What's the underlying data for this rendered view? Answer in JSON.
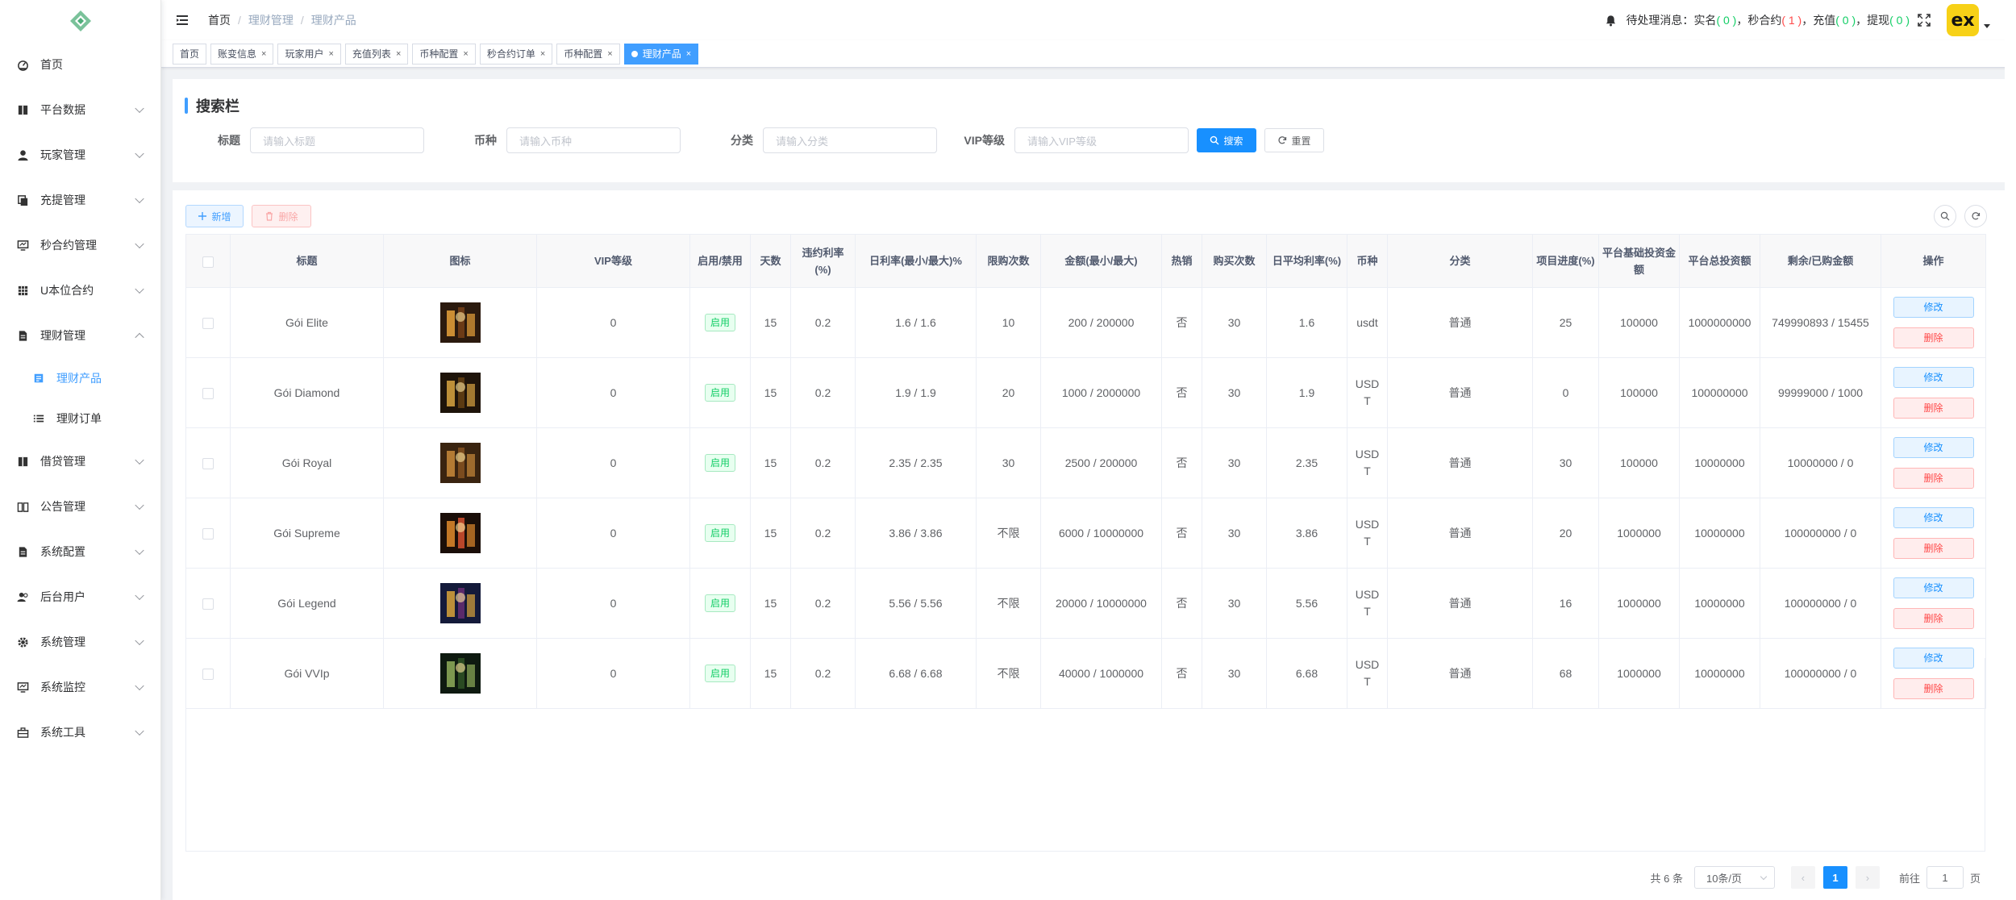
{
  "sidebar": {
    "items": [
      {
        "label": "首页",
        "icon": "dashboard-icon",
        "has_children": false
      },
      {
        "label": "平台数据",
        "icon": "book-icon",
        "has_children": true
      },
      {
        "label": "玩家管理",
        "icon": "user-icon",
        "has_children": true
      },
      {
        "label": "充提管理",
        "icon": "copy-icon",
        "has_children": true
      },
      {
        "label": "秒合约管理",
        "icon": "monitor-icon",
        "has_children": true
      },
      {
        "label": "U本位合约",
        "icon": "grid-icon",
        "has_children": true
      },
      {
        "label": "理财管理",
        "icon": "document-icon",
        "has_children": true,
        "expanded": true
      }
    ],
    "sub_items": [
      {
        "label": "理财产品",
        "icon": "product-icon",
        "active": true
      },
      {
        "label": "理财订单",
        "icon": "list-icon",
        "active": false
      }
    ],
    "items_after": [
      {
        "label": "借贷管理",
        "icon": "book-icon"
      },
      {
        "label": "公告管理",
        "icon": "open-book-icon"
      },
      {
        "label": "系统配置",
        "icon": "document-icon"
      },
      {
        "label": "后台用户",
        "icon": "peoples-icon"
      },
      {
        "label": "系统管理",
        "icon": "gear-icon"
      },
      {
        "label": "系统监控",
        "icon": "monitor-icon"
      },
      {
        "label": "系统工具",
        "icon": "toolbox-icon"
      }
    ]
  },
  "header": {
    "breadcrumb": [
      "首页",
      "理财管理",
      "理财产品"
    ],
    "notice_prefix": "待处理消息：",
    "notice_realname_label": "实名",
    "notice_realname_count": "( 0 )",
    "notice_contract_label": "秒合约",
    "notice_contract_count": "( 1 )",
    "notice_recharge_label": "充值",
    "notice_recharge_count": "( 0 )",
    "notice_withdraw_label": "提现",
    "notice_withdraw_count": "( 0 )",
    "sep_comma": "，",
    "avatar_text": "ex"
  },
  "tags": [
    {
      "label": "首页",
      "closable": false,
      "active": false
    },
    {
      "label": "账变信息",
      "closable": true,
      "active": false
    },
    {
      "label": "玩家用户",
      "closable": true,
      "active": false
    },
    {
      "label": "充值列表",
      "closable": true,
      "active": false
    },
    {
      "label": "币种配置",
      "closable": true,
      "active": false
    },
    {
      "label": "秒合约订单",
      "closable": true,
      "active": false
    },
    {
      "label": "币种配置",
      "closable": true,
      "active": false
    },
    {
      "label": "理财产品",
      "closable": true,
      "active": true
    }
  ],
  "search": {
    "title": "搜索栏",
    "fields": [
      {
        "label": "标题",
        "placeholder": "请输入标题"
      },
      {
        "label": "币种",
        "placeholder": "请输入币种"
      },
      {
        "label": "分类",
        "placeholder": "请输入分类"
      },
      {
        "label": "VIP等级",
        "placeholder": "请输入VIP等级"
      }
    ],
    "search_button": "搜索",
    "reset_button": "重置"
  },
  "toolbar": {
    "add_label": "新增",
    "delete_label": "删除"
  },
  "table": {
    "columns": [
      "标题",
      "图标",
      "VIP等级",
      "启用/禁用",
      "天数",
      "违约利率(%)",
      "日利率(最小/最大)%",
      "限购次数",
      "金额(最小/最大)",
      "热销",
      "购买次数",
      "日平均利率(%)",
      "币种",
      "分类",
      "项目进度(%)",
      "平台基础投资金额",
      "平台总投资额",
      "剩余/已购金额",
      "操作"
    ],
    "rows": [
      {
        "title": "Gói Elite",
        "vip": "0",
        "status": "启用",
        "days": "15",
        "penalty": "0.2",
        "daily_rate": "1.6 / 1.6",
        "limit": "10",
        "amount": "200 / 200000",
        "hot": "否",
        "buy_times": "30",
        "avg_rate": "1.6",
        "coin": "usdt",
        "category": "普通",
        "progress": "25",
        "base_invest": "100000",
        "total_invest": "1000000000",
        "remain": "749990893 / 15455",
        "thumb_colors": [
          "#2b1a0e",
          "#e8a23a",
          "#6b3a16"
        ]
      },
      {
        "title": "Gói Diamond",
        "vip": "0",
        "status": "启用",
        "days": "15",
        "penalty": "0.2",
        "daily_rate": "1.9 / 1.9",
        "limit": "20",
        "amount": "1000 / 2000000",
        "hot": "否",
        "buy_times": "30",
        "avg_rate": "1.9",
        "coin": "USDT",
        "category": "普通",
        "progress": "0",
        "base_invest": "100000",
        "total_invest": "100000000",
        "remain": "99999000 / 1000",
        "thumb_colors": [
          "#1e140a",
          "#d9a441",
          "#5a3a12"
        ]
      },
      {
        "title": "Gói Royal",
        "vip": "0",
        "status": "启用",
        "days": "15",
        "penalty": "0.2",
        "daily_rate": "2.35 / 2.35",
        "limit": "30",
        "amount": "2500 / 200000",
        "hot": "否",
        "buy_times": "30",
        "avg_rate": "2.35",
        "coin": "USDT",
        "category": "普通",
        "progress": "30",
        "base_invest": "100000",
        "total_invest": "10000000",
        "remain": "10000000 / 0",
        "thumb_colors": [
          "#3a2410",
          "#c98a3a",
          "#7a4b1e"
        ]
      },
      {
        "title": "Gói Supreme",
        "vip": "0",
        "status": "启用",
        "days": "15",
        "penalty": "0.2",
        "daily_rate": "3.86 / 3.86",
        "limit": "不限",
        "amount": "6000 / 10000000",
        "hot": "否",
        "buy_times": "30",
        "avg_rate": "3.86",
        "coin": "USDT",
        "category": "普通",
        "progress": "20",
        "base_invest": "1000000",
        "total_invest": "10000000",
        "remain": "100000000 / 0",
        "thumb_colors": [
          "#1a0e08",
          "#e0892c",
          "#b8462a"
        ]
      },
      {
        "title": "Gói Legend",
        "vip": "0",
        "status": "启用",
        "days": "15",
        "penalty": "0.2",
        "daily_rate": "5.56 / 5.56",
        "limit": "不限",
        "amount": "20000 / 10000000",
        "hot": "否",
        "buy_times": "30",
        "avg_rate": "5.56",
        "coin": "USDT",
        "category": "普通",
        "progress": "16",
        "base_invest": "1000000",
        "total_invest": "10000000",
        "remain": "100000000 / 0",
        "thumb_colors": [
          "#141a3a",
          "#d8a43a",
          "#5a2a6a"
        ]
      },
      {
        "title": "Gói VVIp",
        "vip": "0",
        "status": "启用",
        "days": "15",
        "penalty": "0.2",
        "daily_rate": "6.68 / 6.68",
        "limit": "不限",
        "amount": "40000 / 1000000",
        "hot": "否",
        "buy_times": "30",
        "avg_rate": "6.68",
        "coin": "USDT",
        "category": "普通",
        "progress": "68",
        "base_invest": "1000000",
        "total_invest": "10000000",
        "remain": "100000000 / 0",
        "thumb_colors": [
          "#0e1a10",
          "#8fae5a",
          "#2a4a22"
        ]
      }
    ],
    "edit_label": "修改",
    "delete_label": "删除"
  },
  "pagination": {
    "total_text": "共 6 条",
    "page_size": "10条/页",
    "current_page": "1",
    "goto_prefix": "前往",
    "goto_value": "1",
    "goto_suffix": "页"
  },
  "colors": {
    "primary": "#1890ff",
    "success": "#13ce66",
    "danger": "#ff4949"
  }
}
